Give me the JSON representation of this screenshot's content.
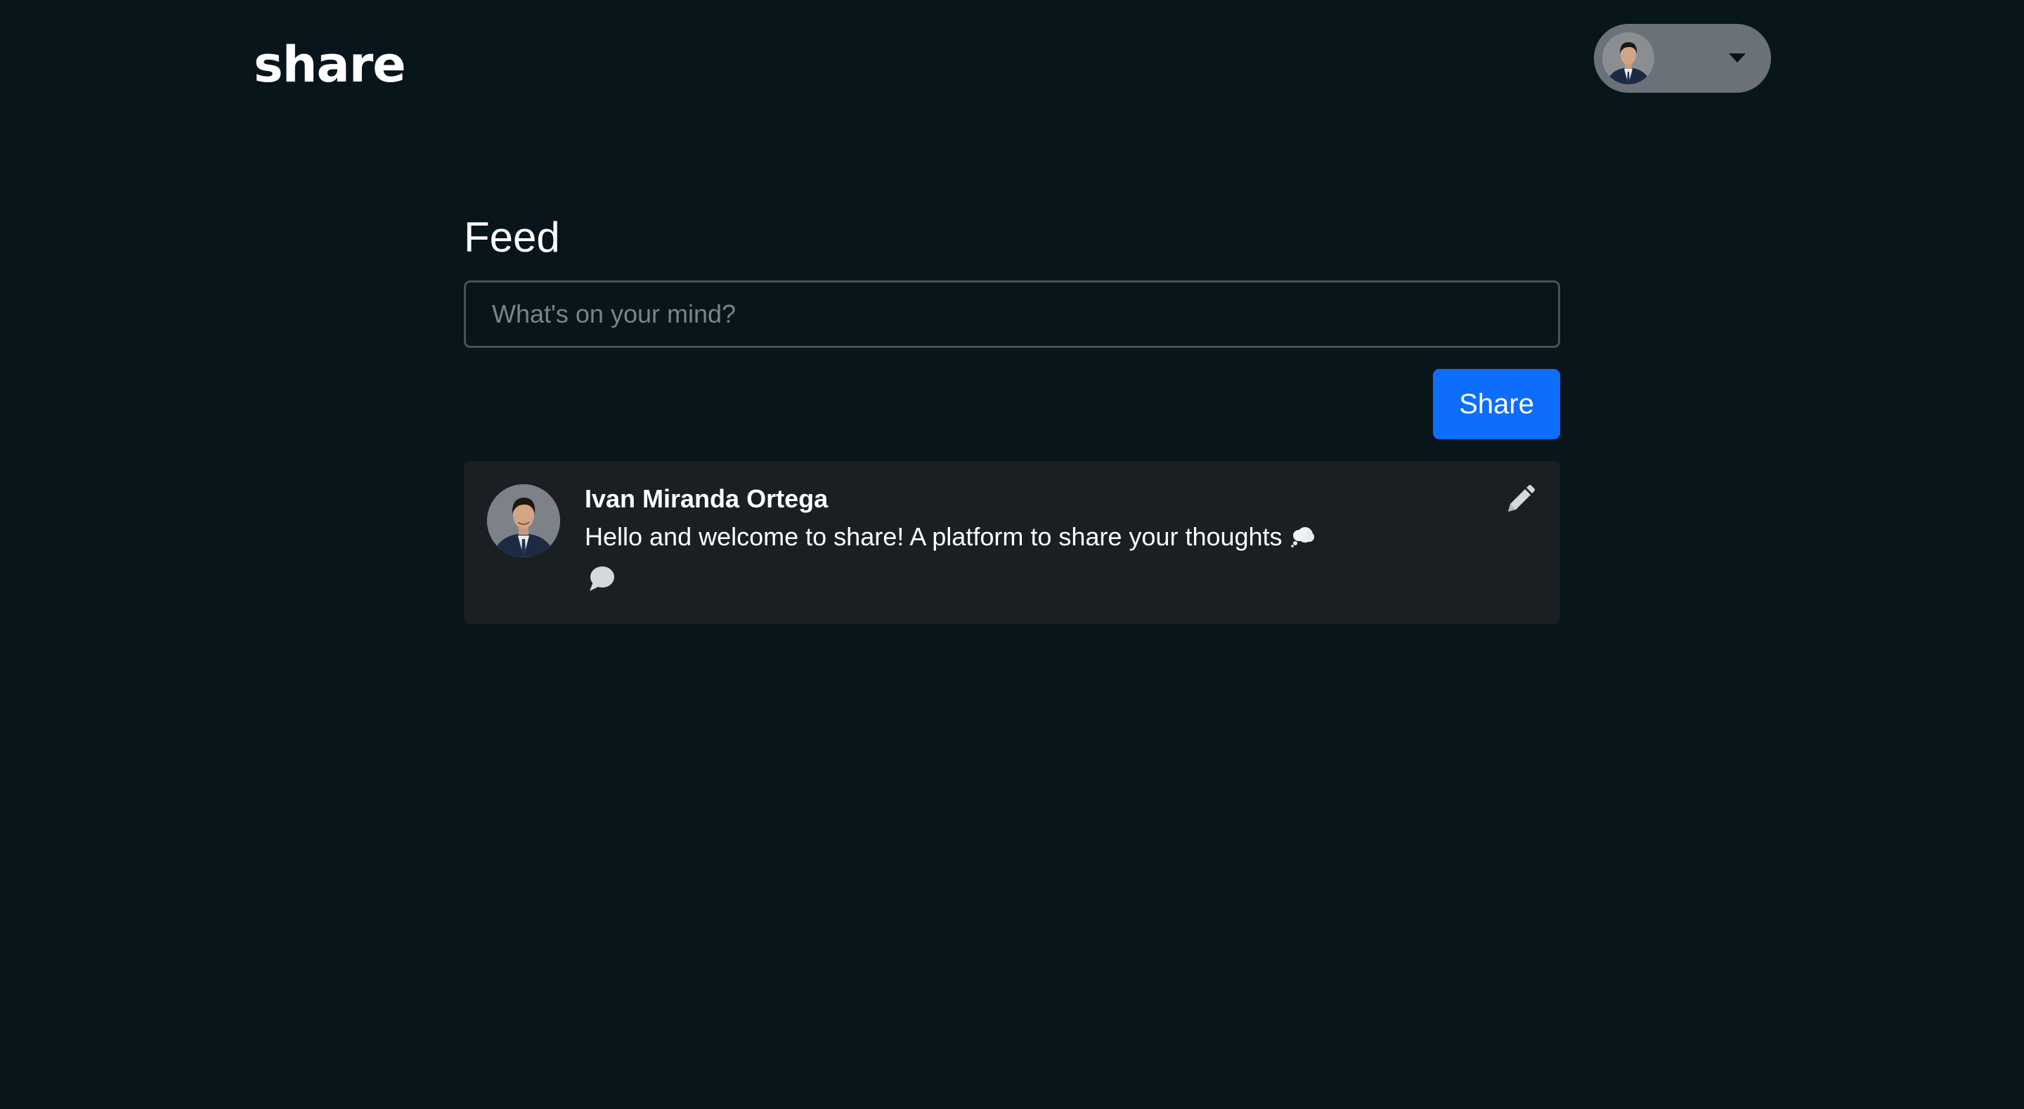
{
  "header": {
    "brand": "share",
    "user_menu": {
      "avatar_icon": "user-avatar-portrait",
      "caret_icon": "caret-down-icon"
    }
  },
  "feed": {
    "title": "Feed",
    "composer": {
      "placeholder": "What's on your mind?",
      "value": "",
      "submit_label": "Share"
    },
    "posts": [
      {
        "author": "Ivan Miranda Ortega",
        "body": "Hello and welcome to share! A platform to share your thoughts",
        "body_emoji_icon": "thought-balloon-icon",
        "actions": {
          "edit_icon": "pencil-icon",
          "comment_icon": "speech-bubble-icon"
        }
      }
    ]
  },
  "colors": {
    "background": "#08151b",
    "card": "#1a1f23",
    "accent": "#0d6efd",
    "pill": "#6b7178",
    "input_border": "#495057",
    "placeholder": "#7b838b"
  }
}
